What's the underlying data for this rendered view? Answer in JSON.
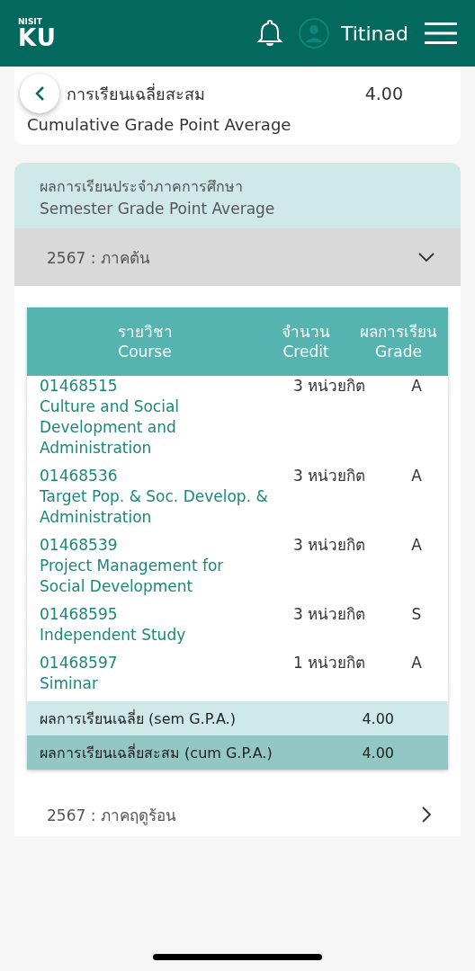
{
  "header": {
    "logo_small": "NISIT",
    "logo": "KU",
    "user_name": "Titinad"
  },
  "cumulative": {
    "label_th": "การเรียนเฉลี่ยสะสม",
    "value": "4.00",
    "label_en": "Cumulative Grade Point Average"
  },
  "semester_card": {
    "title_th": "ผลการเรียนประจำภาคการศึกษา",
    "title_en": "Semester Grade Point Average"
  },
  "semesters": [
    {
      "label": "2567 : ภาคต้น",
      "expanded": true,
      "table": {
        "columns": [
          {
            "th": "รายวิชา",
            "en": "Course"
          },
          {
            "th": "จำนวน",
            "en": "Credit"
          },
          {
            "th": "ผลการเรียน",
            "en": "Grade"
          }
        ],
        "rows": [
          {
            "code": "01468515",
            "name": "Culture and Social Development and Administration",
            "credit": "3 หน่วยกิต",
            "grade": "A"
          },
          {
            "code": "01468536",
            "name": "Target Pop. & Soc. Develop. & Administration",
            "credit": "3 หน่วยกิต",
            "grade": "A"
          },
          {
            "code": "01468539",
            "name": "Project Management for Social Development",
            "credit": "3 หน่วยกิต",
            "grade": "A"
          },
          {
            "code": "01468595",
            "name": "Independent Study",
            "credit": "3 หน่วยกิต",
            "grade": "S"
          },
          {
            "code": "01468597",
            "name": "Siminar",
            "credit": "1 หน่วยกิต",
            "grade": "A"
          }
        ],
        "summary": [
          {
            "kind": "sem",
            "label": "ผลการเรียนเฉลี่ย (sem G.P.A.)",
            "value": "4.00"
          },
          {
            "kind": "cum",
            "label": "ผลการเรียนเฉลี่ยสะสม (cum G.P.A.)",
            "value": "4.00"
          }
        ]
      }
    },
    {
      "label": "2567 : ภาคฤดูร้อน",
      "expanded": false
    }
  ]
}
